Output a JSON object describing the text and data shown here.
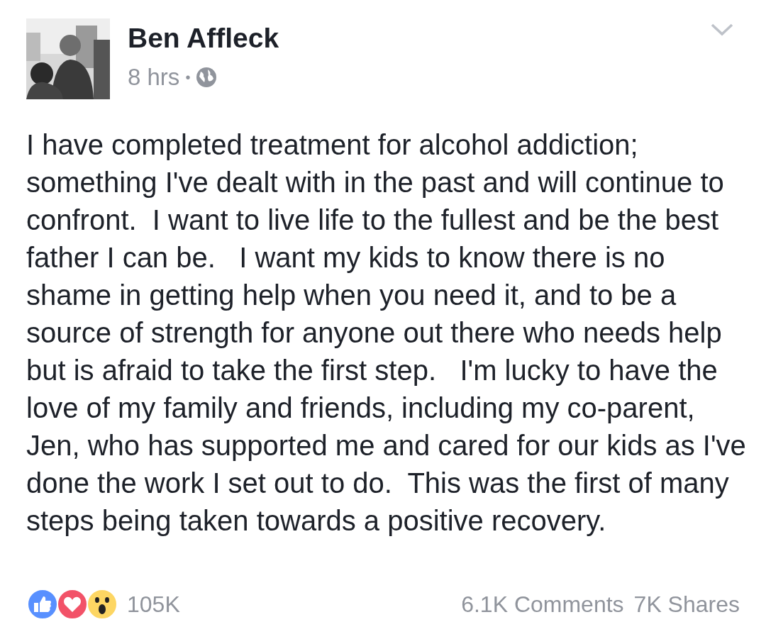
{
  "post": {
    "author": "Ben Affleck",
    "time": "8 hrs",
    "separator": "•",
    "text": "I have completed treatment for alcohol addiction; something I've dealt with in the past and will continue to confront.  I want to live life to the fullest and be the best father I can be.   I want my kids to know there is no shame in getting help when you need it, and to be a source of strength for anyone out there who needs help but is afraid to take the first step.   I'm lucky to have the love of my family and friends, including my co-parent, Jen, who has supported me and cared for our kids as I've done the work I set out to do.  This was the first of many steps being taken towards a positive recovery.",
    "reactions": [
      {
        "kind": "like"
      },
      {
        "kind": "love"
      },
      {
        "kind": "wow"
      }
    ],
    "reaction_count": "105K",
    "comments": "6.1K Comments",
    "shares": "7K Shares"
  }
}
